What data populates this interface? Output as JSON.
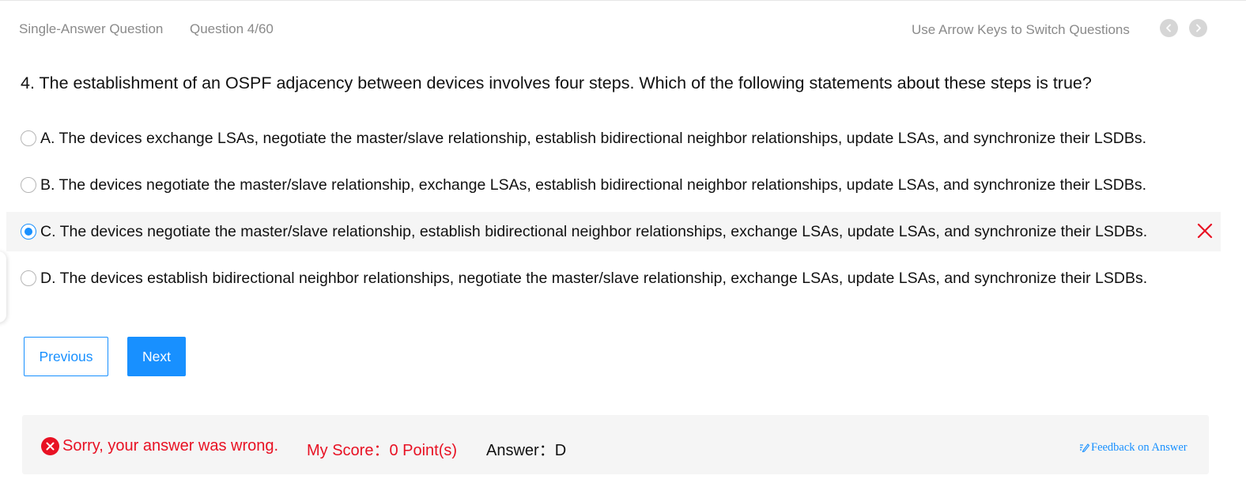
{
  "header": {
    "question_type": "Single-Answer Question",
    "question_number": "Question 4/60",
    "nav_hint": "Use Arrow Keys to Switch Questions"
  },
  "question": {
    "text": "4. The establishment of an OSPF adjacency between devices involves four steps. Which of the following statements about these steps is true?"
  },
  "options": [
    {
      "label": "A. The devices exchange LSAs, negotiate the master/slave relationship, establish bidirectional neighbor relationships, update LSAs, and synchronize their LSDBs.",
      "selected": false
    },
    {
      "label": "B. The devices negotiate the master/slave relationship, exchange LSAs, establish bidirectional neighbor relationships, update LSAs, and synchronize their LSDBs.",
      "selected": false
    },
    {
      "label": "C. The devices negotiate the master/slave relationship, establish bidirectional neighbor relationships, exchange LSAs, update LSAs, and synchronize their LSDBs.",
      "selected": true,
      "marked_wrong": true
    },
    {
      "label": "D. The devices establish bidirectional neighbor relationships, negotiate the master/slave relationship, exchange LSAs, update LSAs, and synchronize their LSDBs.",
      "selected": false
    }
  ],
  "buttons": {
    "previous": "Previous",
    "next": "Next"
  },
  "result": {
    "message": "Sorry, your answer was wrong.",
    "score": "My Score：0 Point(s)",
    "answer": "Answer：D",
    "feedback": "Feedback on Answer"
  },
  "colors": {
    "accent": "#1890ff",
    "error": "#e81123",
    "muted_text": "#8a8a8a",
    "panel_bg": "#f5f5f5"
  },
  "icons": {
    "prev": "chevron-left-icon",
    "next": "chevron-right-icon",
    "wrong": "close-icon",
    "error": "error-circle-icon",
    "feedback": "edit-icon"
  }
}
